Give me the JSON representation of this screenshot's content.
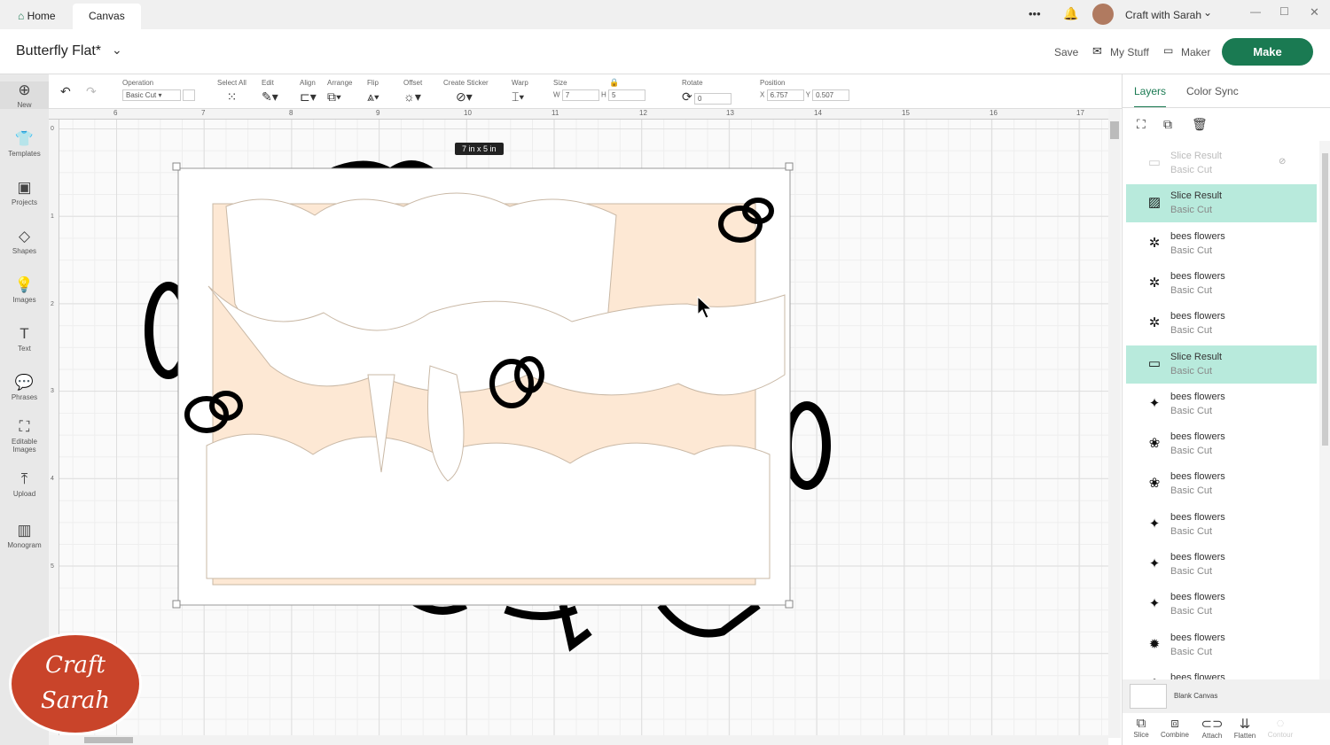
{
  "tabs": [
    {
      "label": "Home"
    },
    {
      "label": "Canvas"
    }
  ],
  "top": {
    "user": "Craft with Sarah",
    "more": "•••"
  },
  "header": {
    "title": "Butterfly Flat*",
    "save": "Save",
    "my_stuff": "My Stuff",
    "maker": "Maker",
    "make": "Make"
  },
  "toolbar": {
    "operation_label": "Operation",
    "operation_value": "Basic Cut",
    "select_all": "Select All",
    "edit": "Edit",
    "align": "Align",
    "arrange": "Arrange",
    "flip": "Flip",
    "offset": "Offset",
    "create_sticker": "Create Sticker",
    "warp": "Warp",
    "size": "Size",
    "w_label": "W",
    "w": "7",
    "h_label": "H",
    "h": "5",
    "rotate": "Rotate",
    "rotate_value": "0",
    "position": "Position",
    "x_label": "X",
    "x": "6.757",
    "y_label": "Y",
    "y": "0.507"
  },
  "sidebar": [
    {
      "label": "New",
      "icon": "⊕"
    },
    {
      "label": "Templates",
      "icon": "👕"
    },
    {
      "label": "Projects",
      "icon": "▣"
    },
    {
      "label": "Shapes",
      "icon": "◇"
    },
    {
      "label": "Images",
      "icon": "💡"
    },
    {
      "label": "Text",
      "icon": "T"
    },
    {
      "label": "Phrases",
      "icon": "💬"
    },
    {
      "label": "Editable Images",
      "icon": "⛶"
    },
    {
      "label": "Upload",
      "icon": "⤒"
    },
    {
      "label": "Monogram",
      "icon": "▥"
    }
  ],
  "ruler": {
    "h": [
      "6",
      "7",
      "8",
      "9",
      "10",
      "11",
      "12",
      "13",
      "14",
      "15",
      "16",
      "17"
    ],
    "v": [
      "0",
      "1",
      "2",
      "3",
      "4",
      "5"
    ]
  },
  "canvas": {
    "size_badge": "7 in x 5 in"
  },
  "panel": {
    "tab_layers": "Layers",
    "tab_color_sync": "Color Sync",
    "layers": [
      {
        "name": "Slice Result",
        "type": "Basic Cut",
        "state": "hidden"
      },
      {
        "name": "Slice Result",
        "type": "Basic Cut",
        "state": "selected"
      },
      {
        "name": "bees flowers",
        "type": "Basic Cut",
        "state": "normal"
      },
      {
        "name": "bees flowers",
        "type": "Basic Cut",
        "state": "normal"
      },
      {
        "name": "bees flowers",
        "type": "Basic Cut",
        "state": "normal"
      },
      {
        "name": "Slice Result",
        "type": "Basic Cut",
        "state": "selected"
      },
      {
        "name": "bees flowers",
        "type": "Basic Cut",
        "state": "normal"
      },
      {
        "name": "bees flowers",
        "type": "Basic Cut",
        "state": "normal"
      },
      {
        "name": "bees flowers",
        "type": "Basic Cut",
        "state": "normal"
      },
      {
        "name": "bees flowers",
        "type": "Basic Cut",
        "state": "normal"
      },
      {
        "name": "bees flowers",
        "type": "Basic Cut",
        "state": "normal"
      },
      {
        "name": "bees flowers",
        "type": "Basic Cut",
        "state": "normal"
      },
      {
        "name": "bees flowers",
        "type": "Basic Cut",
        "state": "normal"
      },
      {
        "name": "bees flowers",
        "type": "",
        "state": "normal"
      }
    ],
    "blank_canvas": "Blank Canvas",
    "bottom": [
      {
        "label": "Slice",
        "icon": "⧉"
      },
      {
        "label": "Combine",
        "icon": "⧈"
      },
      {
        "label": "Attach",
        "icon": "⊂⊃"
      },
      {
        "label": "Flatten",
        "icon": "⇊"
      },
      {
        "label": "Contour",
        "icon": "◌"
      }
    ]
  },
  "watermark": "Craft with Sarah",
  "colors": {
    "make": "#1a7a52",
    "selected": "#b8eadc",
    "peach": "#fde8d4"
  }
}
